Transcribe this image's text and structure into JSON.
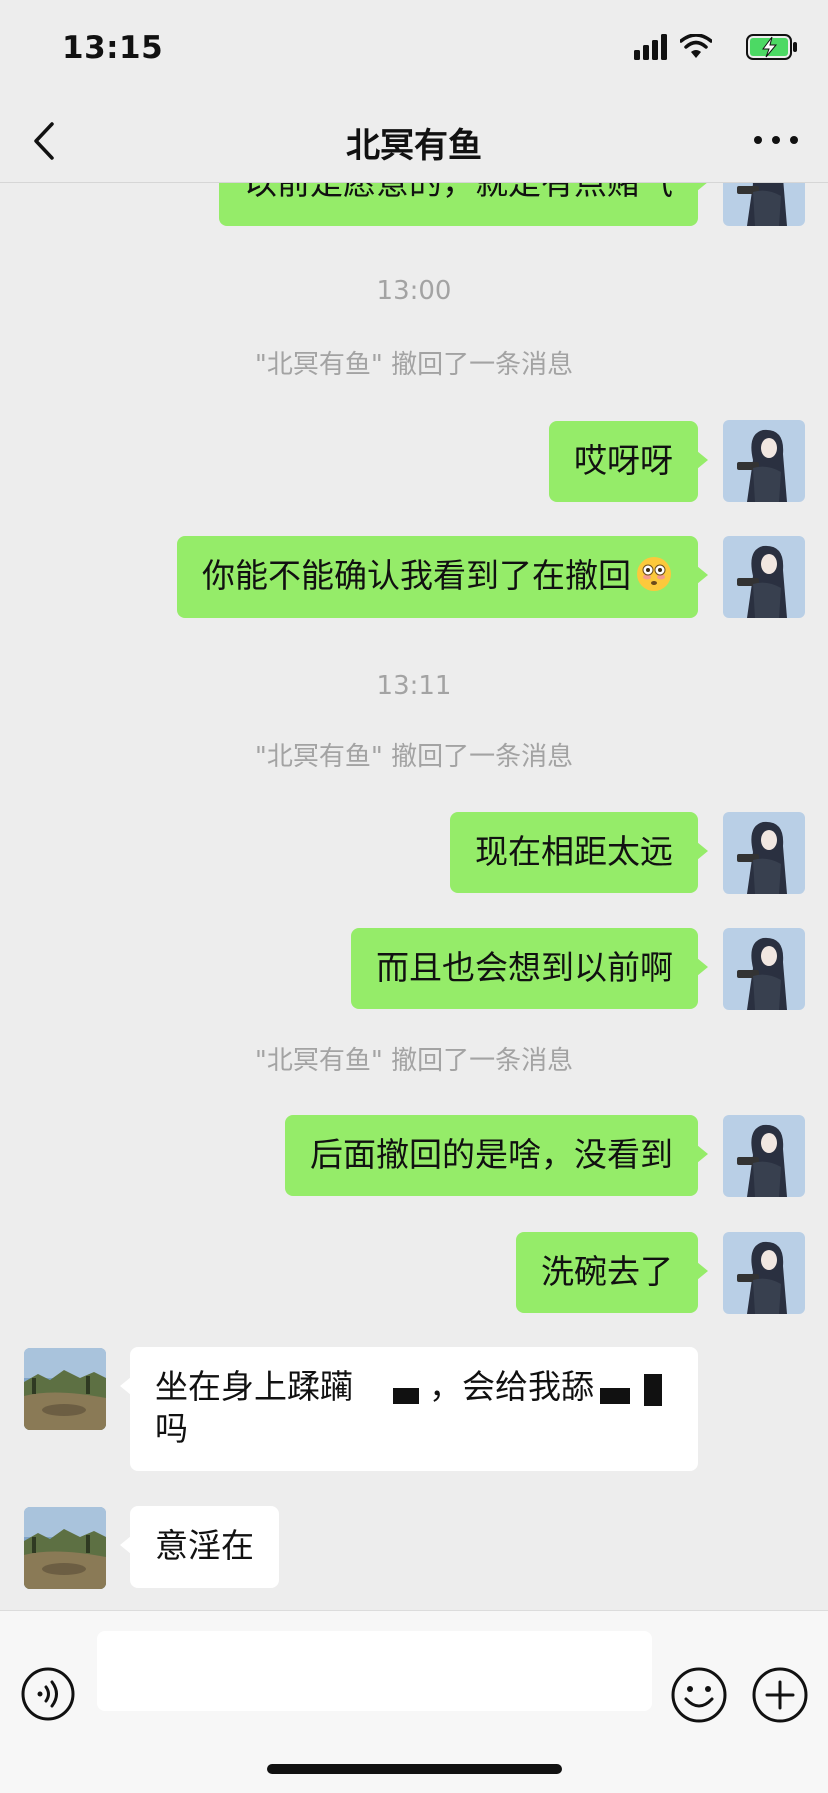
{
  "status_bar": {
    "time": "13:15"
  },
  "header": {
    "title": "北冥有鱼"
  },
  "messages": {
    "m0": "以前是愿意的，就是有点赌气",
    "ts1": "13:00",
    "sys1": "\"北冥有鱼\" 撤回了一条消息",
    "m1": "哎呀呀",
    "m2": "你能不能确认我看到了在撤回",
    "ts2": "13:11",
    "sys2": "\"北冥有鱼\" 撤回了一条消息",
    "m3": "现在相距太远",
    "m4": "而且也会想到以前啊",
    "sys3": "\"北冥有鱼\" 撤回了一条消息",
    "m5": "后面撤回的是啥，没看到",
    "m6": "洗碗去了",
    "o1_line1_a": "坐在身上蹂躏",
    "o1_line1_b": "，会给我舔",
    "o1_line2": "吗",
    "o2": "意淫在"
  },
  "icons": {
    "back": "chevron-left-icon",
    "more": "more-dots-icon",
    "voice": "voice-icon",
    "emoji": "emoji-face-icon",
    "plus": "plus-circle-icon",
    "flushed": "flushed-face-emoji"
  },
  "colors": {
    "my_bubble": "#95ec69",
    "their_bubble": "#ffffff",
    "background": "#ededed",
    "system_text": "#a3a3a3"
  }
}
